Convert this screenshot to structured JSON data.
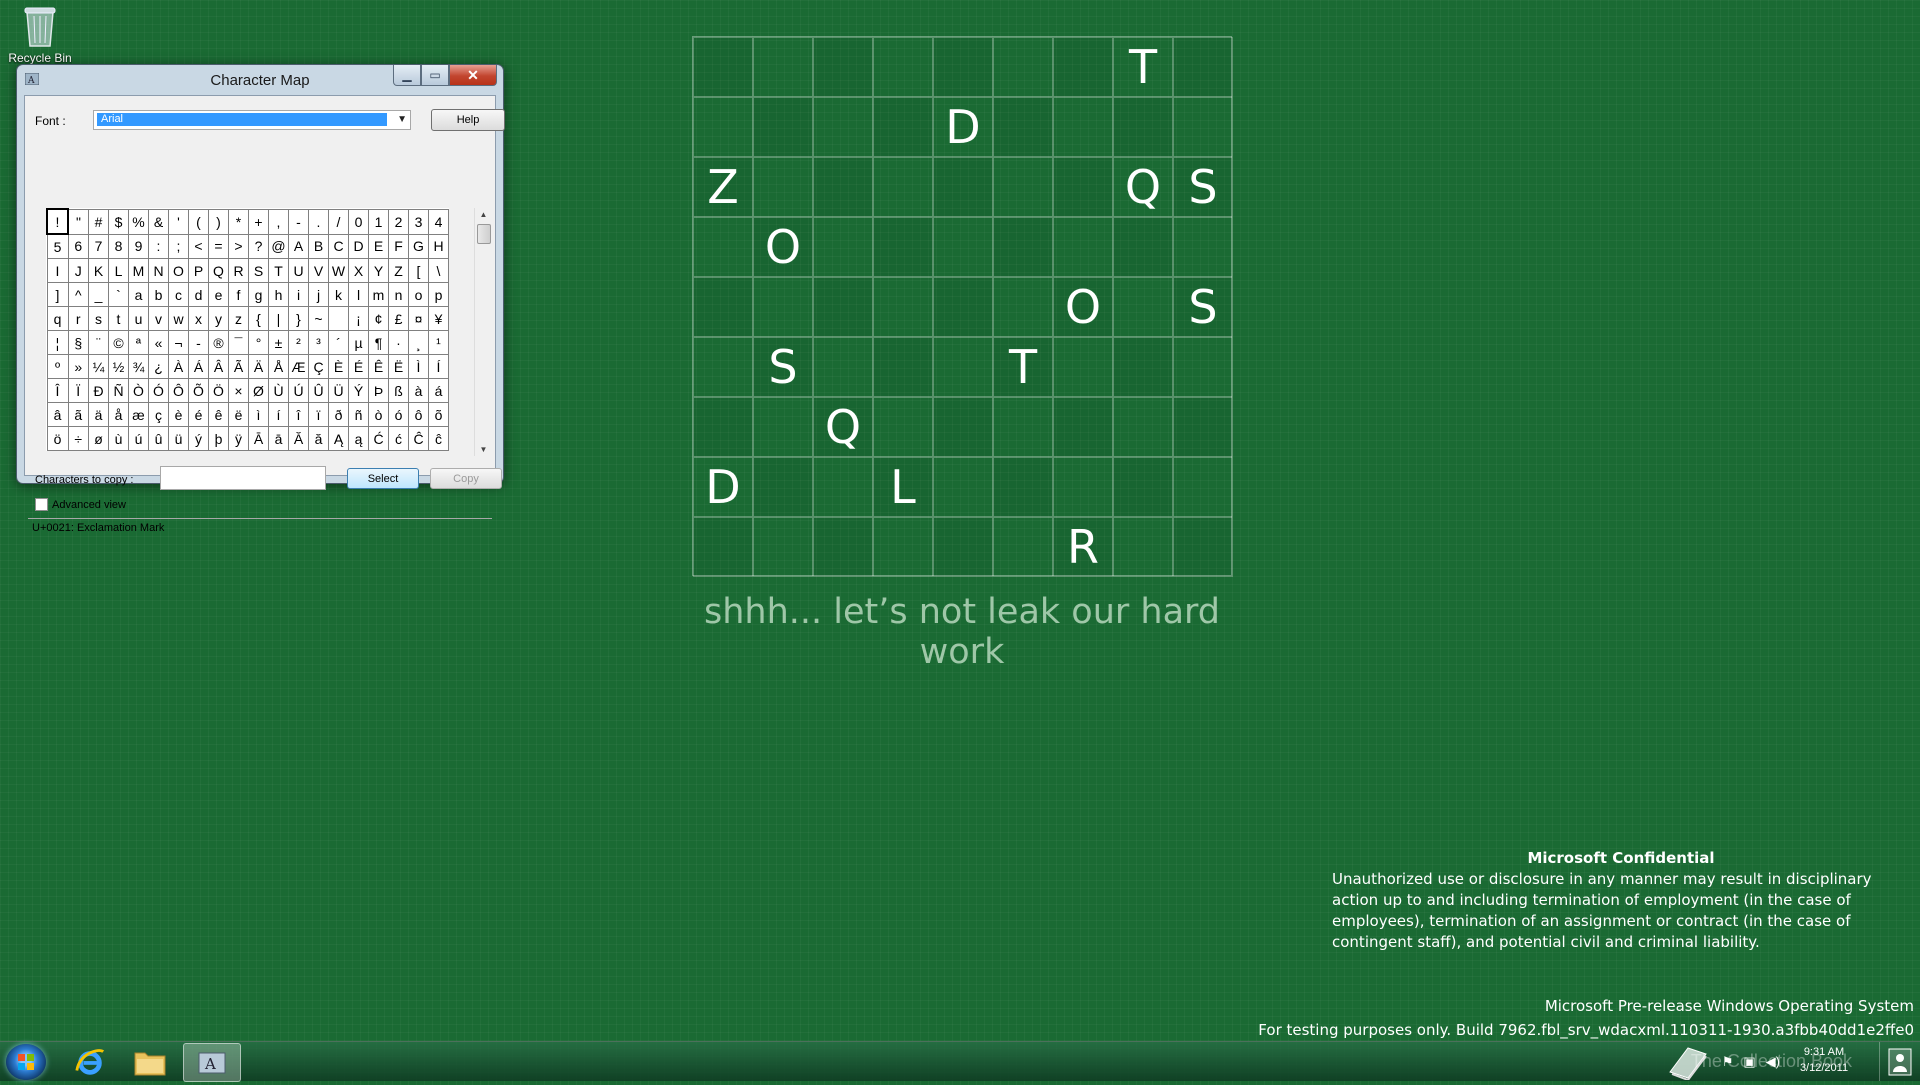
{
  "desktop": {
    "recycle_bin_label": "Recycle Bin"
  },
  "window": {
    "title": "Character Map",
    "font_label": "Font :",
    "font_value": "Arial",
    "help_label": "Help",
    "copy_label": "Characters to copy :",
    "copy_value": "",
    "select_label": "Select",
    "copy_button_label": "Copy",
    "advanced_label": "Advanced view",
    "status": "U+0021: Exclamation Mark",
    "characters": [
      [
        "!",
        "\"",
        "#",
        "$",
        "%",
        "&",
        "'",
        "(",
        ")",
        "*",
        "+",
        ",",
        "-",
        ".",
        "/",
        "0",
        "1",
        "2",
        "3",
        "4"
      ],
      [
        "5",
        "6",
        "7",
        "8",
        "9",
        ":",
        ";",
        "<",
        "=",
        ">",
        "?",
        "@",
        "A",
        "B",
        "C",
        "D",
        "E",
        "F",
        "G",
        "H"
      ],
      [
        "I",
        "J",
        "K",
        "L",
        "M",
        "N",
        "O",
        "P",
        "Q",
        "R",
        "S",
        "T",
        "U",
        "V",
        "W",
        "X",
        "Y",
        "Z",
        "[",
        "\\"
      ],
      [
        "]",
        "^",
        "_",
        "`",
        "a",
        "b",
        "c",
        "d",
        "e",
        "f",
        "g",
        "h",
        "i",
        "j",
        "k",
        "l",
        "m",
        "n",
        "o",
        "p"
      ],
      [
        "q",
        "r",
        "s",
        "t",
        "u",
        "v",
        "w",
        "x",
        "y",
        "z",
        "{",
        "|",
        "}",
        "~",
        " ",
        "¡",
        "¢",
        "£",
        "¤",
        "¥"
      ],
      [
        "¦",
        "§",
        "¨",
        "©",
        "ª",
        "«",
        "¬",
        "-",
        "®",
        "¯",
        "°",
        "±",
        "²",
        "³",
        "´",
        "µ",
        "¶",
        "·",
        "¸",
        "¹"
      ],
      [
        "º",
        "»",
        "¼",
        "½",
        "¾",
        "¿",
        "À",
        "Á",
        "Â",
        "Ã",
        "Ä",
        "Å",
        "Æ",
        "Ç",
        "È",
        "É",
        "Ê",
        "Ë",
        "Ì",
        "Í"
      ],
      [
        "Î",
        "Ï",
        "Ð",
        "Ñ",
        "Ò",
        "Ó",
        "Ô",
        "Õ",
        "Ö",
        "×",
        "Ø",
        "Ù",
        "Ú",
        "Û",
        "Ü",
        "Ý",
        "Þ",
        "ß",
        "à",
        "á"
      ],
      [
        "â",
        "ã",
        "ä",
        "å",
        "æ",
        "ç",
        "è",
        "é",
        "ê",
        "ë",
        "ì",
        "í",
        "î",
        "ï",
        "ð",
        "ñ",
        "ò",
        "ó",
        "ô",
        "õ"
      ],
      [
        "ö",
        "÷",
        "ø",
        "ù",
        "ú",
        "û",
        "ü",
        "ý",
        "þ",
        "ÿ",
        "Ā",
        "ā",
        "Ă",
        "ă",
        "Ą",
        "ą",
        "Ć",
        "ć",
        "Ĉ",
        "ĉ"
      ]
    ]
  },
  "letter_grid": [
    [
      "",
      "",
      "",
      "",
      "",
      "",
      "",
      "T",
      ""
    ],
    [
      "",
      "",
      "",
      "",
      "D",
      "",
      "",
      "",
      ""
    ],
    [
      "Z",
      "",
      "",
      "",
      "",
      "",
      "",
      "Q",
      "S"
    ],
    [
      "",
      "O",
      "",
      "",
      "",
      "",
      "",
      "",
      ""
    ],
    [
      "",
      "",
      "",
      "",
      "",
      "",
      "O",
      "",
      "S"
    ],
    [
      "",
      "S",
      "",
      "",
      "",
      "T",
      "",
      "",
      ""
    ],
    [
      "",
      "",
      "Q",
      "",
      "",
      "",
      "",
      "",
      ""
    ],
    [
      "D",
      "",
      "",
      "L",
      "",
      "",
      "",
      "",
      ""
    ],
    [
      "",
      "",
      "",
      "",
      "",
      "",
      "R",
      "",
      ""
    ]
  ],
  "tagline": "shhh... let’s not leak our hard work",
  "confidential": {
    "heading": "Microsoft Confidential",
    "body": "Unauthorized use or disclosure in any manner may result in disciplinary action up to and including termination of employment (in the case of employees), termination of an assignment or contract (in the case of contingent staff), and potential civil and criminal liability."
  },
  "watermark": {
    "line1": "Microsoft Pre-release Windows Operating System",
    "line2": "For testing purposes only. Build 7962.fbl_srv_wdacxml.110311-1930.a3fbb40dd1e2ffe0"
  },
  "tray": {
    "time": "9:31 AM",
    "date": "3/12/2011",
    "overlay_text": "The Collection Book"
  },
  "colors": {
    "desktop": "#1a6a33",
    "selection": "#3399ff",
    "close_button": "#c2452f"
  }
}
